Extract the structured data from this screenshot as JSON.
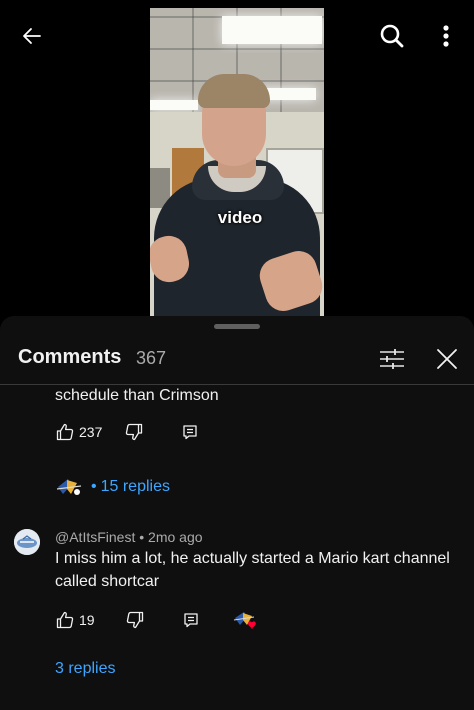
{
  "video": {
    "caption": "video",
    "back_icon": "arrow-left-icon",
    "search_icon": "search-icon",
    "more_icon": "more-vertical-icon"
  },
  "comments": {
    "title": "Comments",
    "count": "367",
    "filter_icon": "sliders-icon",
    "close_icon": "close-icon"
  },
  "comment1": {
    "text_tail": "schedule than Crimson",
    "likes": "237",
    "replies": "15 replies",
    "reply_separator": "•"
  },
  "comment2": {
    "handle": "@AtItsFinest",
    "age": "2mo ago",
    "separator": "•",
    "text": "I miss him a lot, he actually started a Mario kart channel called shortcar",
    "likes": "19",
    "replies": "3 replies"
  },
  "colors": {
    "background": "#000000",
    "sheet": "#0f0f0f",
    "link": "#3ea6ff",
    "secondary_text": "#aaaaaa",
    "heart": "#ff0033"
  }
}
